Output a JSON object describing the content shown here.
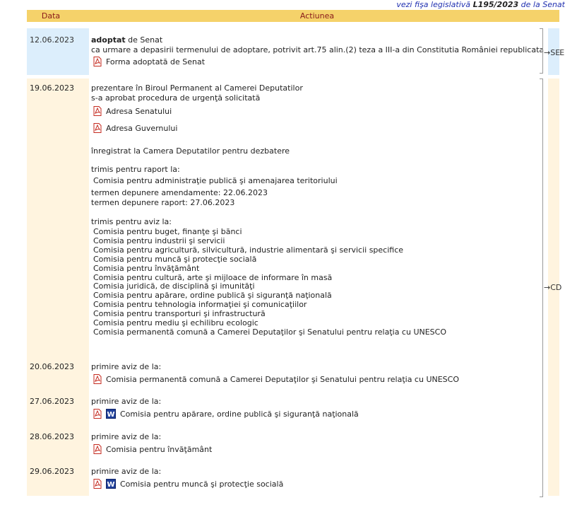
{
  "top_link": {
    "prefix": "vezi fişa legislativă",
    "code": "L195/2023",
    "suffix": "de la Senat"
  },
  "header": {
    "data": "Data",
    "actiunea": "Actiunea"
  },
  "colors": {
    "header_bg": "#f5d26a",
    "senate_bg": "#dceefc",
    "cd_bg": "#fff4df",
    "header_text": "#8a1a1a"
  },
  "senat": {
    "date": "12.06.2023",
    "adopted": "adoptat",
    "by": "de Senat",
    "reason": "ca urmare a depasirii termenului de adoptare, potrivit art.75 alin.(2) teza a III-a din Constitutia României republicata",
    "form": "Forma adoptată de Senat",
    "side": "→SE"
  },
  "cd": {
    "side": "→CD",
    "entries": [
      {
        "date": "19.06.2023"
      },
      {
        "date": "20.06.2023"
      },
      {
        "date": "27.06.2023"
      },
      {
        "date": "28.06.2023"
      },
      {
        "date": "29.06.2023"
      }
    ],
    "e1": {
      "l1": "prezentare în Biroul Permanent al Camerei Deputatilor",
      "l2": "s-a aprobat procedura de urgenţă solicitată",
      "doc1": "Adresa Senatului",
      "doc2": "Adresa Guvernului",
      "reg": "înregistrat la Camera Deputatilor pentru dezbatere",
      "raport_title": "trimis pentru raport la:",
      "raport_com": "Comisia pentru administraţie publică şi amenajarea teritoriului",
      "term_amend": "termen depunere amendamente: 22.06.2023",
      "term_raport": "termen depunere raport: 27.06.2023",
      "aviz_title": "trimis pentru aviz la:",
      "aviz": [
        "Comisia pentru buget, finanţe şi bănci",
        "Comisia pentru industrii şi servicii",
        "Comisia pentru agricultură, silvicultură, industrie alimentară şi servicii specifice",
        "Comisia pentru muncă şi protecţie socială",
        "Comisia pentru învăţământ",
        "Comisia pentru cultură, arte şi mijloace de informare în masă",
        "Comisia juridică, de disciplină şi imunităţi",
        "Comisia pentru apărare, ordine publică şi siguranţă naţională",
        "Comisia pentru tehnologia informaţiei şi comunicaţiilor",
        "Comisia pentru transporturi şi infrastructură",
        "Comisia pentru mediu şi echilibru ecologic",
        "Comisia permanentă comună a Camerei Deputaţilor şi Senatului pentru relaţia cu UNESCO"
      ]
    },
    "primire": "primire aviz de la:",
    "e2_com": "Comisia permanentă comună a Camerei Deputaţilor şi Senatului pentru relaţia cu UNESCO",
    "e3_com": "Comisia pentru apărare, ordine publică şi siguranţă naţională",
    "e4_com": "Comisia pentru învăţământ",
    "e5_com": "Comisia pentru muncă şi protecţie socială"
  }
}
